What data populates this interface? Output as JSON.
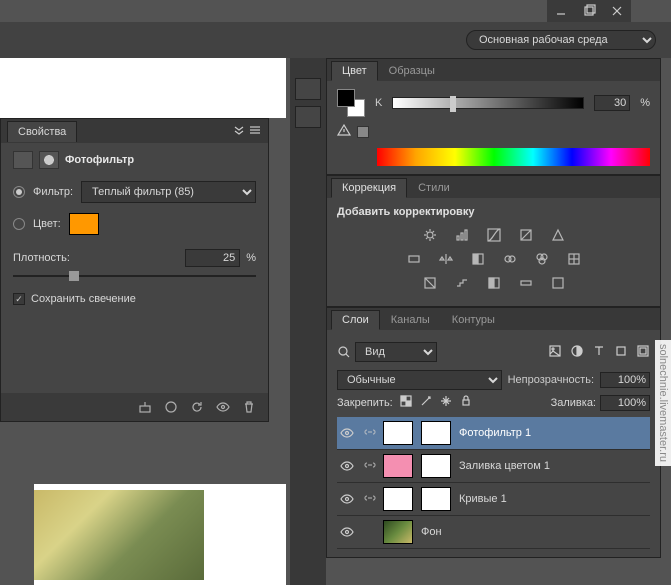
{
  "window": {
    "workspace": "Основная рабочая среда"
  },
  "properties": {
    "panel_title": "Свойства",
    "title": "Фотофильтр",
    "filter_label": "Фильтр:",
    "filter_value": "Теплый фильтр (85)",
    "color_label": "Цвет:",
    "color_hex": "#ff9800",
    "density_label": "Плотность:",
    "density_value": "25",
    "density_unit": "%",
    "preserve_label": "Сохранить свечение",
    "preserve_checked": true
  },
  "color_panel": {
    "tabs": [
      "Цвет",
      "Образцы"
    ],
    "k_label": "K",
    "k_value": "30",
    "k_unit": "%"
  },
  "adjustments": {
    "tabs": [
      "Коррекция",
      "Стили"
    ],
    "title": "Добавить корректировку"
  },
  "layers_panel": {
    "tabs": [
      "Слои",
      "Каналы",
      "Контуры"
    ],
    "kind_label": "Вид",
    "blend_mode": "Обычные",
    "opacity_label": "Непрозрачность:",
    "opacity_value": "100%",
    "lock_label": "Закрепить:",
    "fill_label": "Заливка:",
    "fill_value": "100%",
    "layers": [
      {
        "name": "Фотофильтр 1",
        "thumb": "white",
        "mask": true,
        "selected": true
      },
      {
        "name": "Заливка цветом 1",
        "thumb": "pink",
        "mask": true,
        "selected": false
      },
      {
        "name": "Кривые 1",
        "thumb": "white",
        "mask": true,
        "selected": false
      },
      {
        "name": "Фон",
        "thumb": "img",
        "mask": false,
        "selected": false
      }
    ]
  },
  "watermark": "solnechnie.livemaster.ru"
}
